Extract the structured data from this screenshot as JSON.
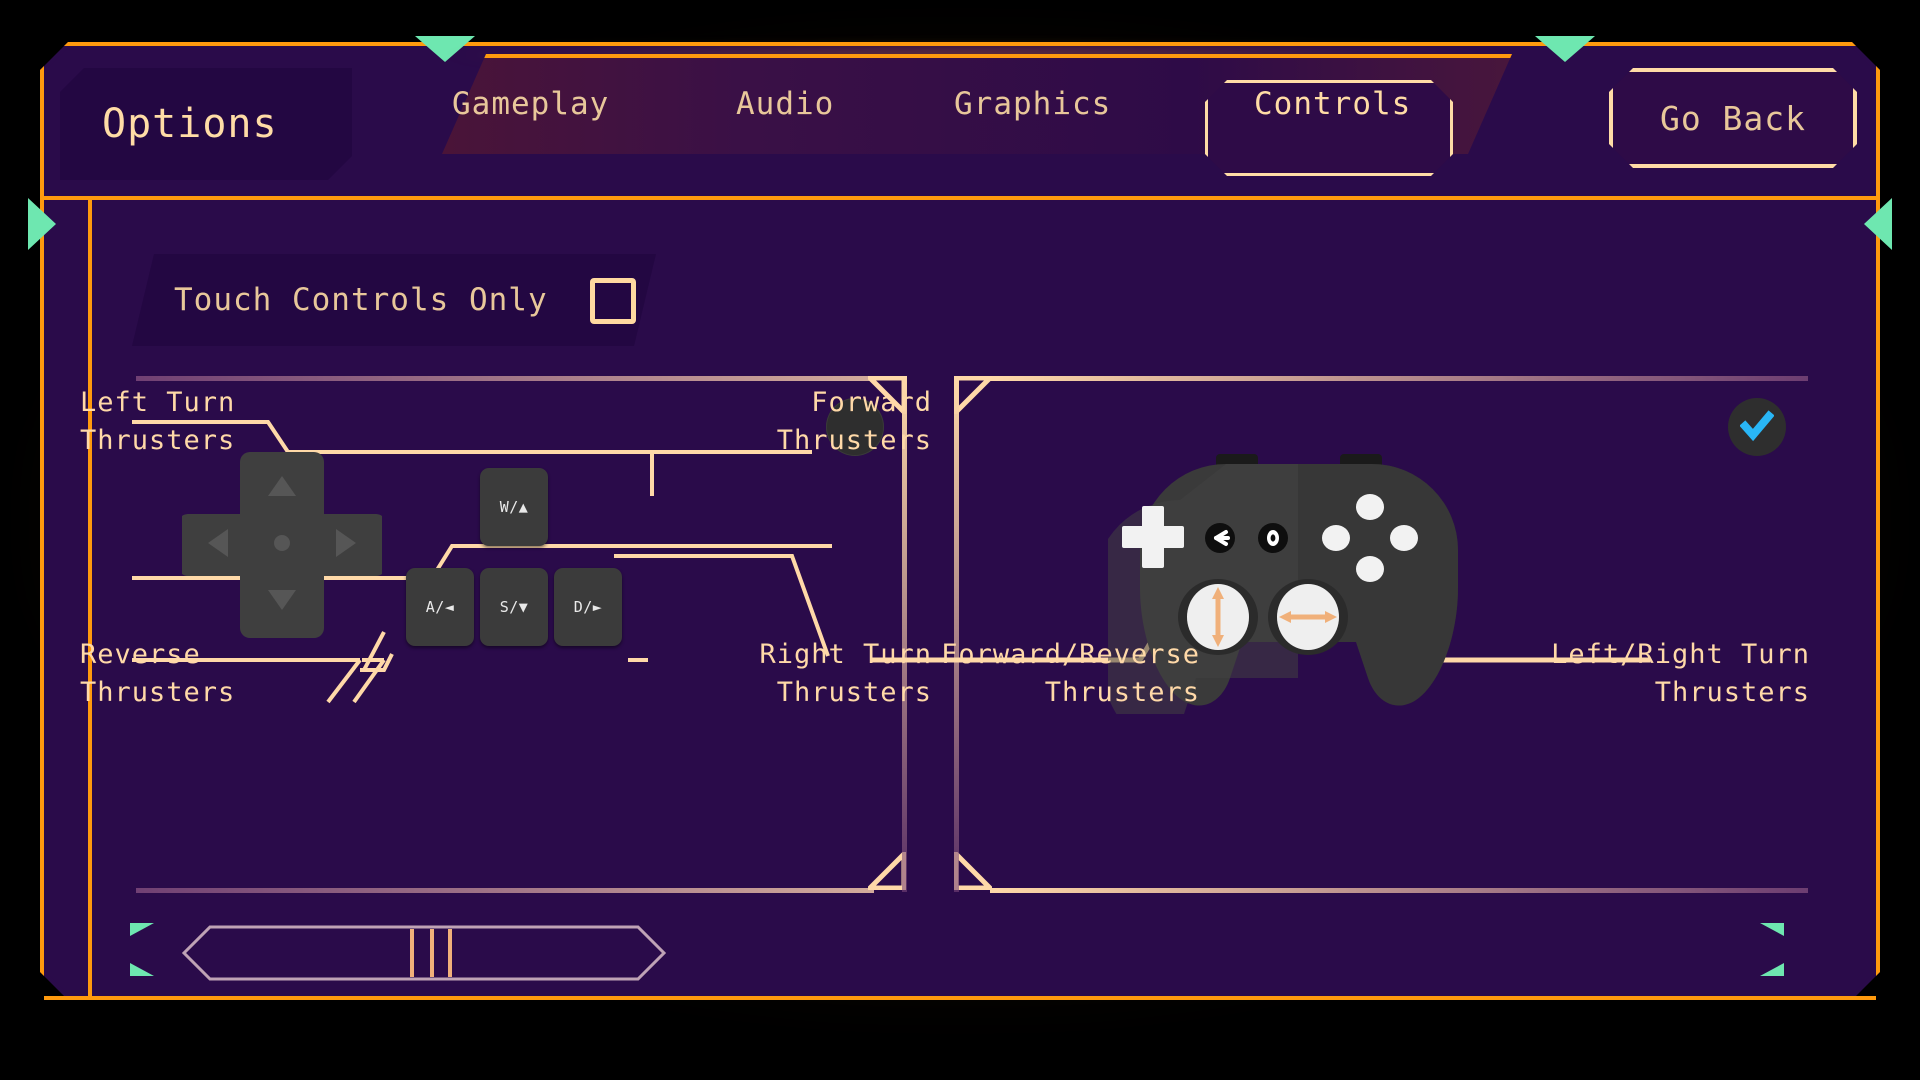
{
  "window": {
    "title": "Options",
    "theme": {
      "frame_orange": "#FF9A0E",
      "panel_purple": "#2A0B4A",
      "plate_purple": "#230742",
      "text_cream": "#FFDCA6",
      "text_tan": "#E8C79A",
      "accent_green": "#6EE7B0",
      "check_blue": "#29B6F6",
      "key_gray": "#3B3B3B"
    }
  },
  "header": {
    "title": "Options",
    "tabs": [
      {
        "label": "Gameplay",
        "active": false
      },
      {
        "label": "Audio",
        "active": false
      },
      {
        "label": "Graphics",
        "active": false
      },
      {
        "label": "Controls",
        "active": true
      }
    ],
    "go_back_label": "Go Back"
  },
  "settings": {
    "touch_controls": {
      "label": "Touch Controls Only",
      "checked": false,
      "checkbox_icon": "empty-checkbox-icon"
    }
  },
  "schemes": [
    {
      "id": "keyboard",
      "selected": false,
      "selector_icon": "radio-unselected-icon",
      "keys": [
        {
          "id": "w",
          "label": "W/▲"
        },
        {
          "id": "a",
          "label": "A/◄"
        },
        {
          "id": "s",
          "label": "S/▼"
        },
        {
          "id": "d",
          "label": "D/►"
        }
      ],
      "labels": {
        "top_left": "Left Turn\nThrusters",
        "top_right": "Forward\nThrusters",
        "bottom_left": "Reverse\nThrusters",
        "bottom_right": "Right Turn\nThrusters"
      },
      "label_lines": {
        "top_left_1": "Left Turn",
        "top_left_2": "Thrusters",
        "top_right_1": "Forward",
        "top_right_2": "Thrusters",
        "bottom_left_1": "Reverse",
        "bottom_left_2": "Thrusters",
        "bottom_right_1": "Right Turn",
        "bottom_right_2": "Thrusters"
      }
    },
    {
      "id": "gamepad",
      "selected": true,
      "selector_icon": "checkmark-selected-icon",
      "label_lines": {
        "bottom_left_1": "Forward/Reverse",
        "bottom_left_2": "Thrusters",
        "bottom_right_1": "Left/Right Turn",
        "bottom_right_2": "Thrusters"
      }
    }
  ],
  "footer": {
    "slider_icon": "hex-slider-track",
    "ticks": 3,
    "nav_icon_left": "chevron-left-icon"
  }
}
